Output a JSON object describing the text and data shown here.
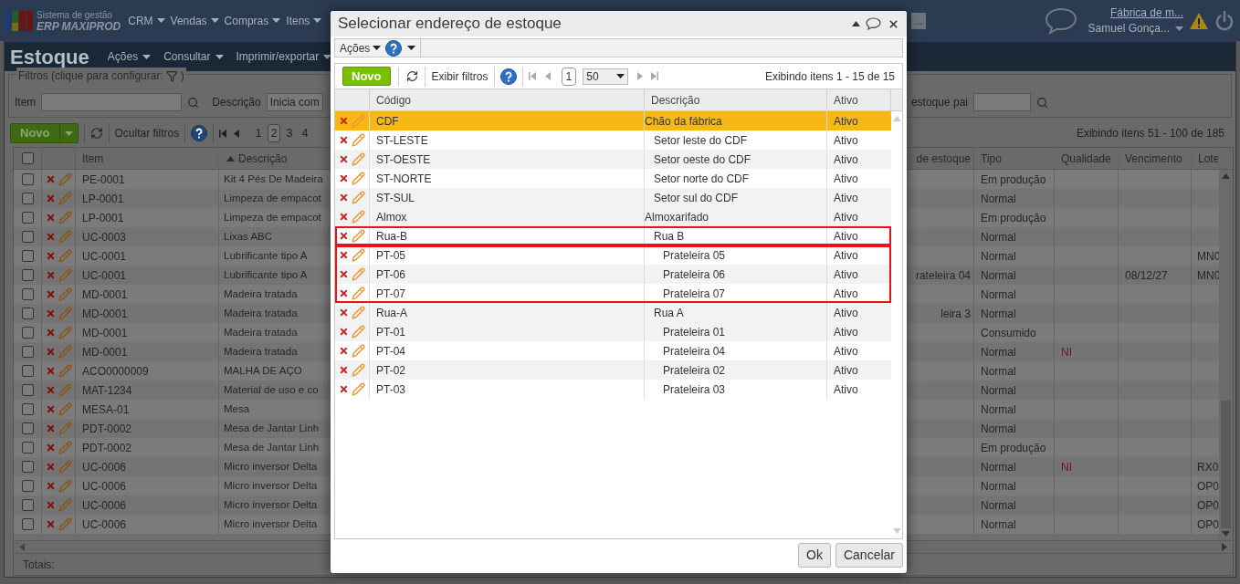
{
  "top_bar": {
    "logo_line_1": "Sistema de gestão",
    "logo_line_2": "ERP MAXIPROD",
    "menus": [
      "CRM",
      "Vendas",
      "Compras",
      "Itens"
    ],
    "more_button": "...",
    "company_link": "Fábrica de m...",
    "user": "Samuel Gonça..."
  },
  "page": {
    "title": "Estoque",
    "menus": [
      "Ações",
      "Consultar",
      "Imprimir/exportar"
    ],
    "filters": {
      "legend": "Filtros (clique para configurar:",
      "legend_end": ")",
      "item_label": "Item",
      "description_label": "Descrição",
      "description_mode": "Inicia com",
      "parent_label": "estoque pai"
    },
    "toolbar": {
      "new_button": "Novo",
      "filter_button": "Ocultar filtros",
      "pages": [
        {
          "label": "1",
          "selected": false
        },
        {
          "label": "2",
          "selected": true
        },
        {
          "label": "3",
          "selected": false
        },
        {
          "label": "4",
          "selected": false
        }
      ],
      "summary": "Exibindo itens 51 - 100 de 185"
    },
    "columns": {
      "item": "Item",
      "description": "Descrição",
      "column_5": "de estoque",
      "type": "Tipo",
      "quality": "Qualidade",
      "expiry": "Vencimento",
      "lot": "Lote"
    },
    "rows": [
      {
        "checked": false,
        "item": "PE-0001",
        "description": "Kit 4 Pés De Madeira",
        "type": "Em produção"
      },
      {
        "checked": false,
        "item": "LP-0001",
        "description": "Limpeza de empacot",
        "type": "Normal"
      },
      {
        "checked": false,
        "item": "LP-0001",
        "description": "Limpeza de empacot",
        "type": "Em produção"
      },
      {
        "checked": false,
        "item": "UC-0003",
        "description": "Lixas ABC",
        "type": "Normal"
      },
      {
        "checked": false,
        "item": "UC-0001",
        "description": "Lubrificante tipo A",
        "type": "Normal",
        "lot": "MN0"
      },
      {
        "checked": false,
        "item": "UC-0001",
        "description": "Lubrificante tipo A",
        "column_5": "rateleira 04",
        "type": "Normal",
        "expiry": "08/12/27",
        "lot": "MN0"
      },
      {
        "checked": false,
        "item": "MD-0001",
        "description": "Madeira tratada",
        "type": "Normal"
      },
      {
        "checked": false,
        "item": "MD-0001",
        "description": "Madeira tratada",
        "column_5": "leira 3",
        "type": "Normal"
      },
      {
        "checked": false,
        "item": "MD-0001",
        "description": "Madeira tratada",
        "type": "Consumido"
      },
      {
        "checked": false,
        "item": "MD-0001",
        "description": "Madeira tratada",
        "type": "Normal",
        "quality": "NI"
      },
      {
        "checked": false,
        "item": "ACO0000009",
        "description": "MALHA DE AÇO",
        "type": "Normal"
      },
      {
        "checked": false,
        "item": "MAT-1234",
        "description": "Material de uso e co",
        "type": "Normal"
      },
      {
        "checked": false,
        "item": "MESA-01",
        "description": "Mesa",
        "type": "Normal"
      },
      {
        "checked": false,
        "item": "PDT-0002",
        "description": "Mesa de Jantar Linh",
        "type": "Normal"
      },
      {
        "checked": false,
        "item": "PDT-0002",
        "description": "Mesa de Jantar Linh",
        "type": "Em produção"
      },
      {
        "checked": false,
        "item": "UC-0006",
        "description": "Micro inversor Delta",
        "type": "Normal",
        "quality": "NI",
        "lot": "RX0"
      },
      {
        "checked": false,
        "item": "UC-0006",
        "description": "Micro inversor Delta",
        "type": "Normal",
        "lot": "OP0"
      },
      {
        "checked": false,
        "item": "UC-0006",
        "description": "Micro inversor Delta",
        "type": "Normal",
        "lot": "OP0"
      },
      {
        "checked": false,
        "item": "UC-0006",
        "description": "Micro inversor Delta",
        "type": "Normal",
        "lot": "OP0"
      }
    ],
    "totals_label": "Totais:",
    "select_all_checked": false
  },
  "dialog": {
    "title": "Selecionar endereço de estoque",
    "actions_menu": "Ações",
    "toolbar": {
      "new_button": "Novo",
      "filter_button": "Exibir filtros",
      "page": "1",
      "page_size": "50",
      "summary": "Exibindo itens 1 - 15 de 15"
    },
    "columns": {
      "code": "Código",
      "description": "Descrição",
      "status": "Ativo"
    },
    "tree": [
      {
        "code": "CDF",
        "description": "Chão da fábrica",
        "status": "Ativo",
        "selected": true,
        "framed": false,
        "children_framed": false,
        "children": [
          {
            "code": "ST-LESTE",
            "description": "Setor leste do CDF",
            "status": "Ativo",
            "selected": false,
            "framed": false
          },
          {
            "code": "ST-OESTE",
            "description": "Setor oeste do CDF",
            "status": "Ativo",
            "selected": false,
            "framed": false
          },
          {
            "code": "ST-NORTE",
            "description": "Setor norte do CDF",
            "status": "Ativo",
            "selected": false,
            "framed": false
          },
          {
            "code": "ST-SUL",
            "description": "Setor sul do CDF",
            "status": "Ativo",
            "selected": false,
            "framed": false
          }
        ]
      },
      {
        "code": "Almox",
        "description": "Almoxarifado",
        "status": "Ativo",
        "selected": false,
        "framed": false,
        "children_framed": false,
        "children": [
          {
            "code": "Rua-B",
            "description": "Rua B",
            "status": "Ativo",
            "selected": false,
            "framed": true,
            "children_framed": true,
            "children": [
              {
                "code": "PT-05",
                "description": "Prateleira 05",
                "status": "Ativo",
                "selected": false,
                "framed": false
              },
              {
                "code": "PT-06",
                "description": "Prateleira 06",
                "status": "Ativo",
                "selected": false,
                "framed": false
              },
              {
                "code": "PT-07",
                "description": "Prateleira 07",
                "status": "Ativo",
                "selected": false,
                "framed": false
              }
            ]
          },
          {
            "code": "Rua-A",
            "description": "Rua A",
            "status": "Ativo",
            "selected": false,
            "framed": false,
            "children_framed": false,
            "children": [
              {
                "code": "PT-01",
                "description": "Prateleira 01",
                "status": "Ativo",
                "selected": false,
                "framed": false
              },
              {
                "code": "PT-04",
                "description": "Prateleira 04",
                "status": "Ativo",
                "selected": false,
                "framed": false
              },
              {
                "code": "PT-02",
                "description": "Prateleira 02",
                "status": "Ativo",
                "selected": false,
                "framed": false
              },
              {
                "code": "PT-03",
                "description": "Prateleira 03",
                "status": "Ativo",
                "selected": false,
                "framed": false
              }
            ]
          }
        ]
      }
    ],
    "buttons": [
      "Ok",
      "Cancelar"
    ]
  }
}
